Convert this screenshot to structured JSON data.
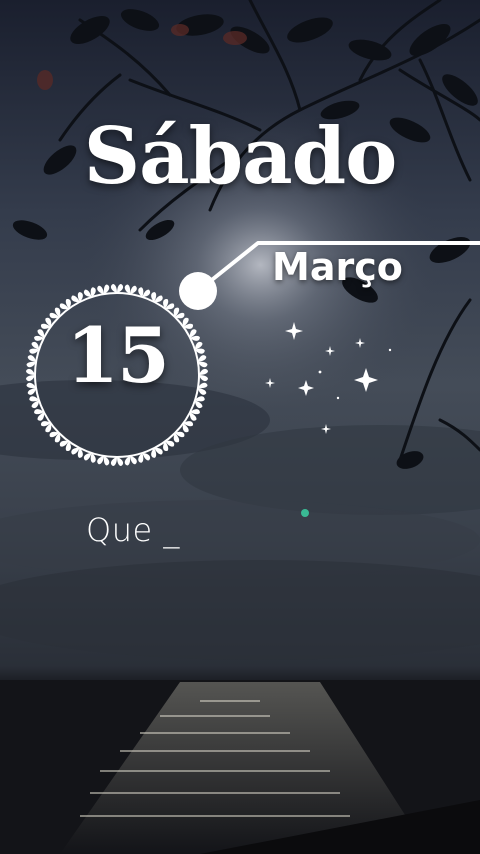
{
  "story": {
    "day_name": "Sábado",
    "month": "Março",
    "day_number": "15",
    "typed_text": "Que _"
  },
  "colors": {
    "sky_top": "#1b2030",
    "sky_mid": "#3a4350",
    "sea": "#14161c",
    "text": "#ffffff"
  },
  "icons": [
    "wreath-circle-icon",
    "sparkle-icon",
    "clock-hand-line-icon"
  ]
}
